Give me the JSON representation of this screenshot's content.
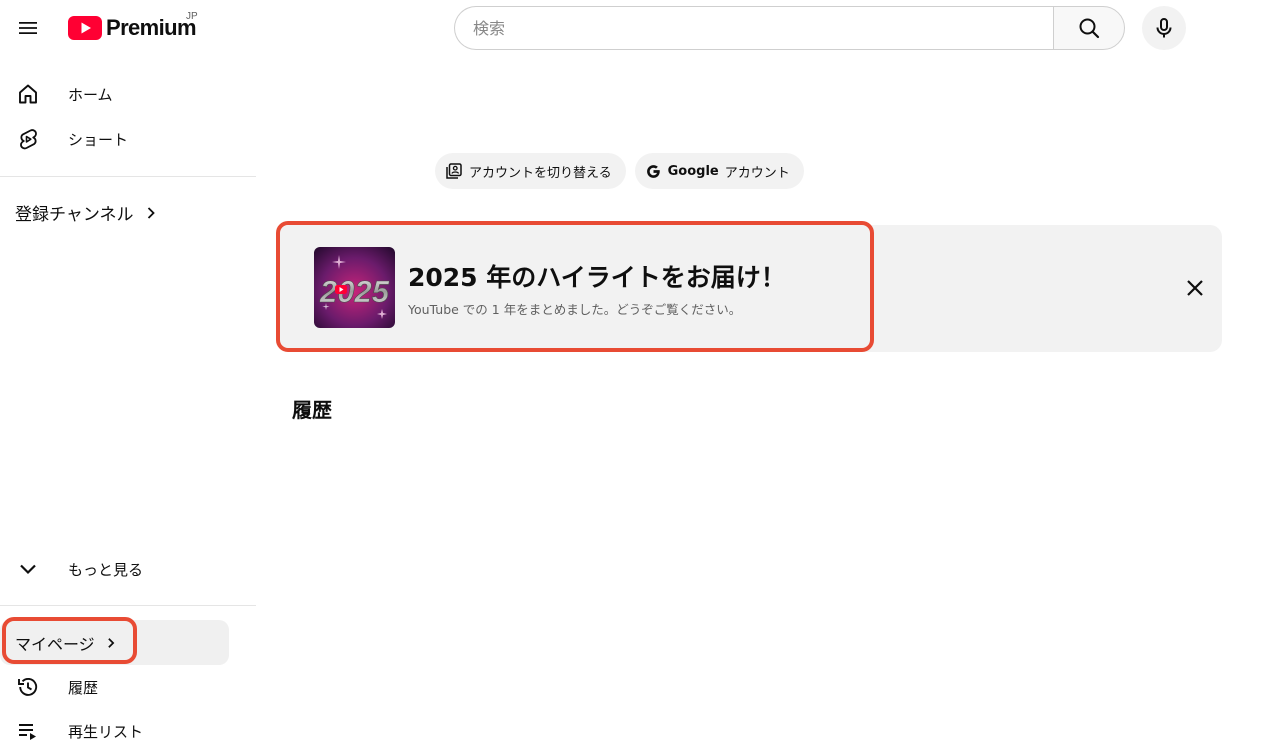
{
  "masthead": {
    "menu_icon": "hamburger-menu-icon",
    "logo_text": "Premium",
    "logo_region": "JP",
    "search_placeholder": "検索",
    "search_icon": "search-icon",
    "mic_icon": "microphone-icon"
  },
  "sidebar": {
    "top_items": [
      {
        "label": "ホーム",
        "icon": "home-icon"
      },
      {
        "label": "ショート",
        "icon": "shorts-icon"
      }
    ],
    "subscriptions_label": "登録チャンネル",
    "show_more_label": "もっと見る",
    "my_page_label": "マイページ",
    "library_items": [
      {
        "label": "履歴",
        "icon": "history-icon"
      },
      {
        "label": "再生リスト",
        "icon": "playlist-icon"
      }
    ]
  },
  "main": {
    "chips": [
      {
        "label": "アカウントを切り替える",
        "icon": "switch-account-icon"
      },
      {
        "brand": "Google",
        "label": "アカウント",
        "icon": "google-g-icon"
      }
    ],
    "banner": {
      "thumbnail_text": "2025",
      "title": "2025 年のハイライトをお届け！",
      "subtitle": "YouTube での 1 年をまとめました。どうぞご覧ください。",
      "close_icon": "close-icon"
    },
    "history_title": "履歴"
  },
  "colors": {
    "brand_red": "#ff0033",
    "highlight": "#e84b34",
    "chip_bg": "#f2f2f2",
    "banner_bg": "#f2f2f2"
  }
}
